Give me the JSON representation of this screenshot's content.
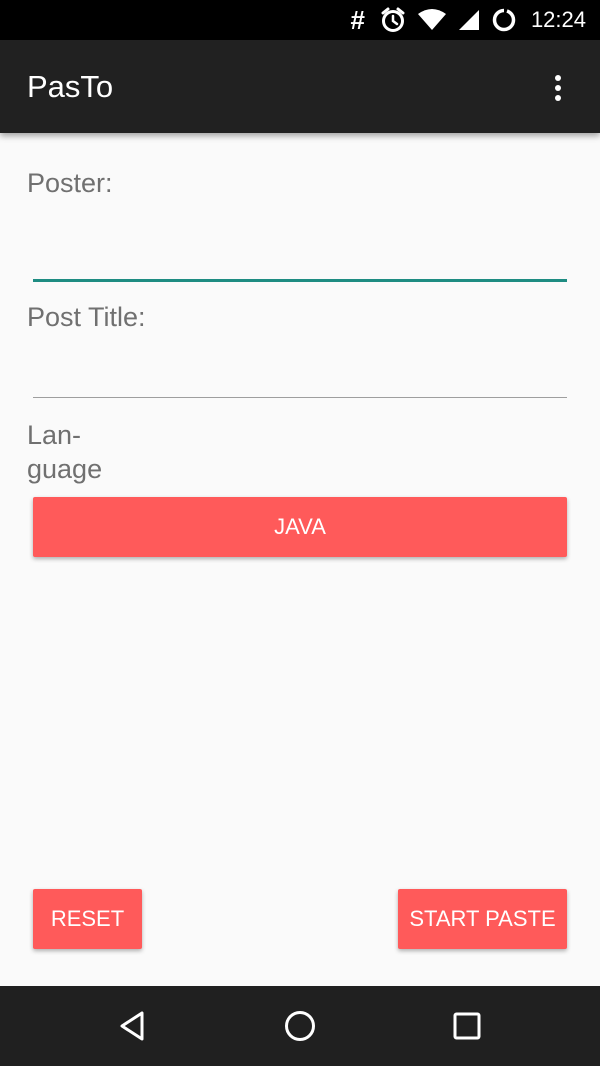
{
  "status_bar": {
    "sim_symbol": "#",
    "time": "12:24",
    "icons": [
      "alarm-icon",
      "wifi-icon",
      "signal-icon",
      "sync-icon"
    ]
  },
  "app_bar": {
    "title": "PasTo",
    "menu_icon": "overflow-menu-icon"
  },
  "form": {
    "poster_label": "Poster:",
    "poster_value": "",
    "post_title_label": "Post Title:",
    "post_title_value": "",
    "language_label": "Lan-\nguage",
    "language_value": "JAVA"
  },
  "actions": {
    "reset_label": "RESET",
    "start_paste_label": "START PASTE"
  },
  "nav_bar": {
    "icons": [
      "back-icon",
      "home-icon",
      "recents-icon"
    ]
  },
  "colors": {
    "accent": "#ff5a5a",
    "focus_underline": "#1e8c82",
    "app_bar": "#212121"
  }
}
